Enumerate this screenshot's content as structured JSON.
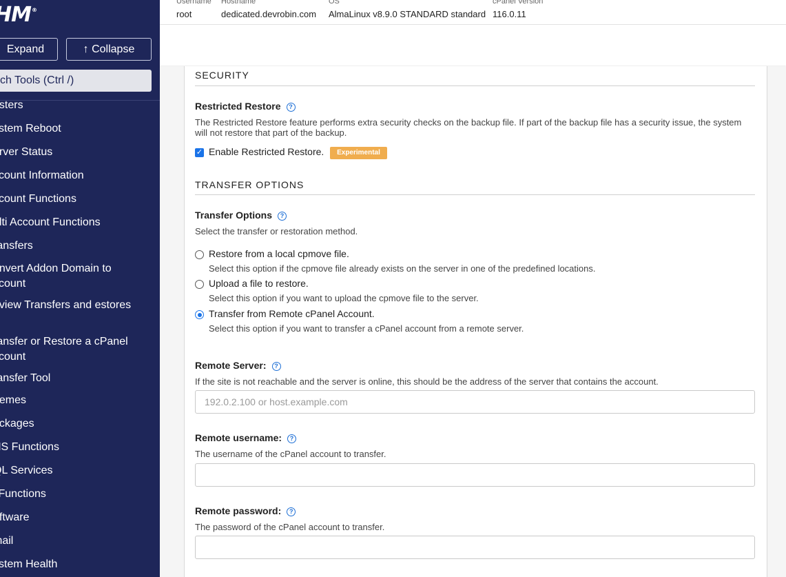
{
  "sidebar": {
    "logo": "HM",
    "logo_mark": "®",
    "expand_label": "Expand",
    "collapse_label": "↑ Collapse",
    "search_placeholder": "ch Tools (Ctrl /)",
    "items": [
      {
        "label": "usters"
      },
      {
        "label": "ystem Reboot"
      },
      {
        "label": "erver Status"
      },
      {
        "label": "ccount Information"
      },
      {
        "label": "ccount Functions"
      },
      {
        "label": "ulti Account Functions"
      },
      {
        "label": "ransfers"
      },
      {
        "label": "onvert Addon Domain to ccount"
      },
      {
        "label": "eview Transfers and estores"
      },
      {
        "label": "ransfer or Restore a cPanel ccount"
      },
      {
        "label": "ransfer Tool"
      },
      {
        "label": "hemes"
      },
      {
        "label": "ackages"
      },
      {
        "label": "NS Functions"
      },
      {
        "label": "QL Services"
      },
      {
        "label": "' Functions"
      },
      {
        "label": "oftware"
      },
      {
        "label": "mail"
      },
      {
        "label": "ystem Health"
      }
    ]
  },
  "topbar": {
    "username_label": "Username",
    "username": "root",
    "hostname_label": "Hostname",
    "hostname": "dedicated.devrobin.com",
    "os_label": "OS",
    "os": "AlmaLinux v8.9.0 STANDARD standard",
    "cpanel_label": "cPanel Version",
    "cpanel_version": "116.0.11"
  },
  "security": {
    "title": "SECURITY",
    "restricted_label": "Restricted Restore",
    "restricted_desc": "The Restricted Restore feature performs extra security checks on the backup file. If part of the backup file has a security issue, the system will not restore that part of the backup.",
    "enable_label": "Enable Restricted Restore.",
    "enable_checked": true,
    "badge": "Experimental",
    "badge_color": "#f0ad4e"
  },
  "transfer": {
    "title": "TRANSFER OPTIONS",
    "options_label": "Transfer Options",
    "options_desc": "Select the transfer or restoration method.",
    "options": [
      {
        "label": "Restore from a local cpmove file.",
        "help": "Select this option if the cpmove file already exists on the server in one of the predefined locations.",
        "selected": false
      },
      {
        "label": "Upload a file to restore.",
        "help": "Select this option if you want to upload the cpmove file to the server.",
        "selected": false
      },
      {
        "label": "Transfer from Remote cPanel Account.",
        "help": "Select this option if you want to transfer a cPanel account from a remote server.",
        "selected": true
      }
    ]
  },
  "remote_server": {
    "label": "Remote Server:",
    "desc": "If the site is not reachable and the server is online, this should be the address of the server that contains the account.",
    "placeholder": "192.0.2.100 or host.example.com",
    "value": ""
  },
  "remote_username": {
    "label": "Remote username:",
    "desc": "The username of the cPanel account to transfer.",
    "value": ""
  },
  "remote_password": {
    "label": "Remote password:",
    "desc": "The password of the cPanel account to transfer.",
    "value": ""
  },
  "accent_color": "#1a73e8",
  "sidebar_color": "#1e2659"
}
